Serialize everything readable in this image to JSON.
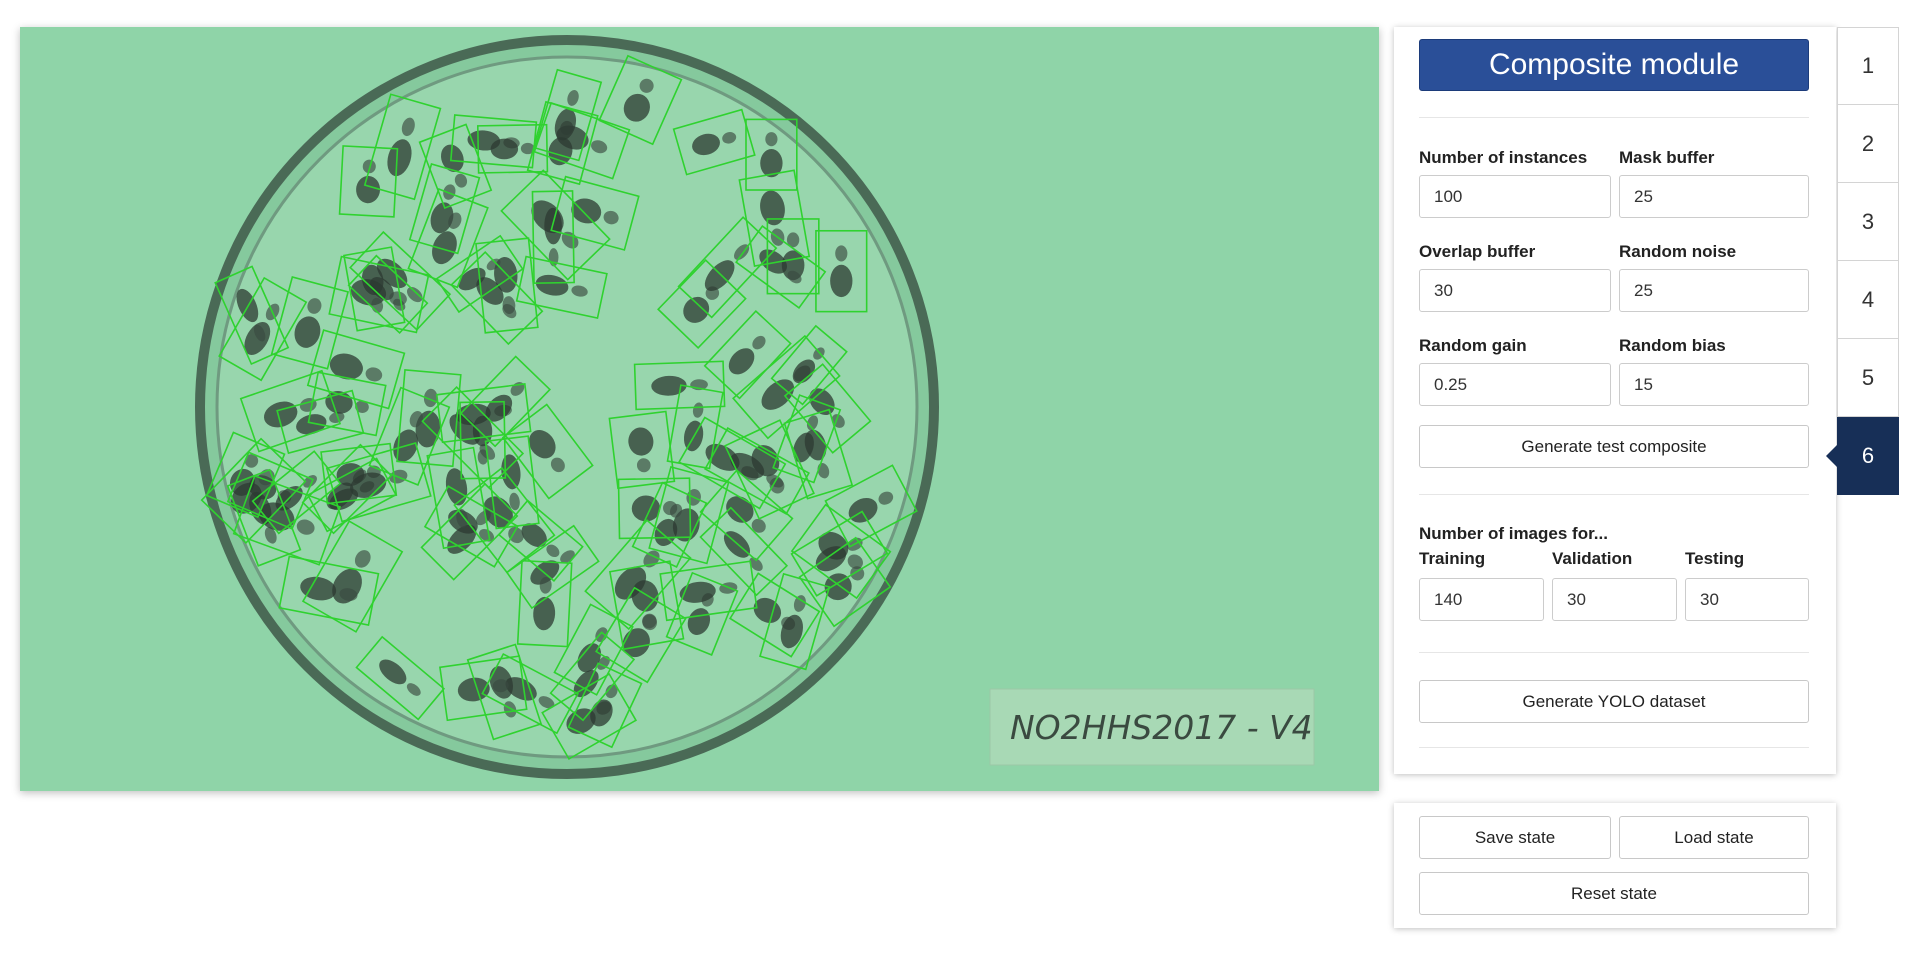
{
  "viewer": {
    "dish_label": "NO2HHS2017 - V4",
    "background_color": "#8fd4a8",
    "box_color": "#2fd22f"
  },
  "panel": {
    "title": "Composite module",
    "fields": {
      "num_instances": {
        "label": "Number of instances",
        "value": "100"
      },
      "mask_buffer": {
        "label": "Mask buffer",
        "value": "25"
      },
      "overlap_buffer": {
        "label": "Overlap buffer",
        "value": "30"
      },
      "random_noise": {
        "label": "Random noise",
        "value": "25"
      },
      "random_gain": {
        "label": "Random gain",
        "value": "0.25"
      },
      "random_bias": {
        "label": "Random bias",
        "value": "15"
      }
    },
    "generate_test_label": "Generate test composite",
    "images_heading": "Number of images for...",
    "split": {
      "training": {
        "label": "Training",
        "value": "140"
      },
      "validation": {
        "label": "Validation",
        "value": "30"
      },
      "testing": {
        "label": "Testing",
        "value": "30"
      }
    },
    "generate_yolo_label": "Generate YOLO dataset"
  },
  "state_panel": {
    "save_label": "Save state",
    "load_label": "Load state",
    "reset_label": "Reset state"
  },
  "tabs": [
    {
      "label": "1",
      "active": false
    },
    {
      "label": "2",
      "active": false
    },
    {
      "label": "3",
      "active": false
    },
    {
      "label": "4",
      "active": false
    },
    {
      "label": "5",
      "active": false
    },
    {
      "label": "6",
      "active": true
    }
  ],
  "accent_color": "#2a4f98",
  "active_tab_color": "#172f57"
}
